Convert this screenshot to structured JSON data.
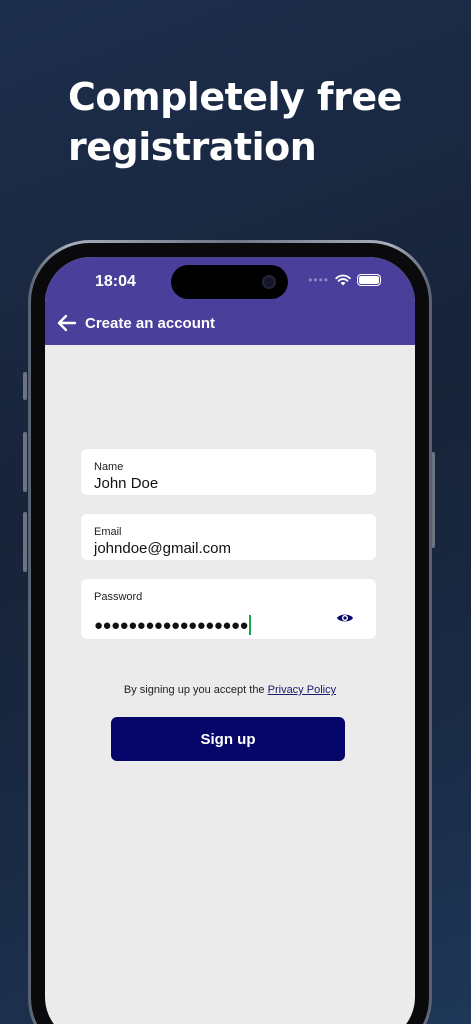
{
  "headline": {
    "line1": "Completely free",
    "line2": "registration"
  },
  "status_bar": {
    "time": "18:04"
  },
  "appbar": {
    "title": "Create an account",
    "back_icon": "arrow-left-icon"
  },
  "form": {
    "name": {
      "label": "Name",
      "value": "John Doe"
    },
    "email": {
      "label": "Email",
      "value": "johndoe@gmail.com"
    },
    "password": {
      "label": "Password",
      "value": "●●●●●●●●●●●●●●●●●●",
      "toggle_icon": "eye-icon"
    }
  },
  "policy": {
    "text": "By signing up you accept the ",
    "link": "Privacy Policy"
  },
  "signup_button": {
    "label": "Sign up"
  },
  "colors": {
    "appbar": "#4a3f9a",
    "button": "#06056a",
    "screen_bg": "#ebebeb",
    "cursor": "#17a34a"
  }
}
